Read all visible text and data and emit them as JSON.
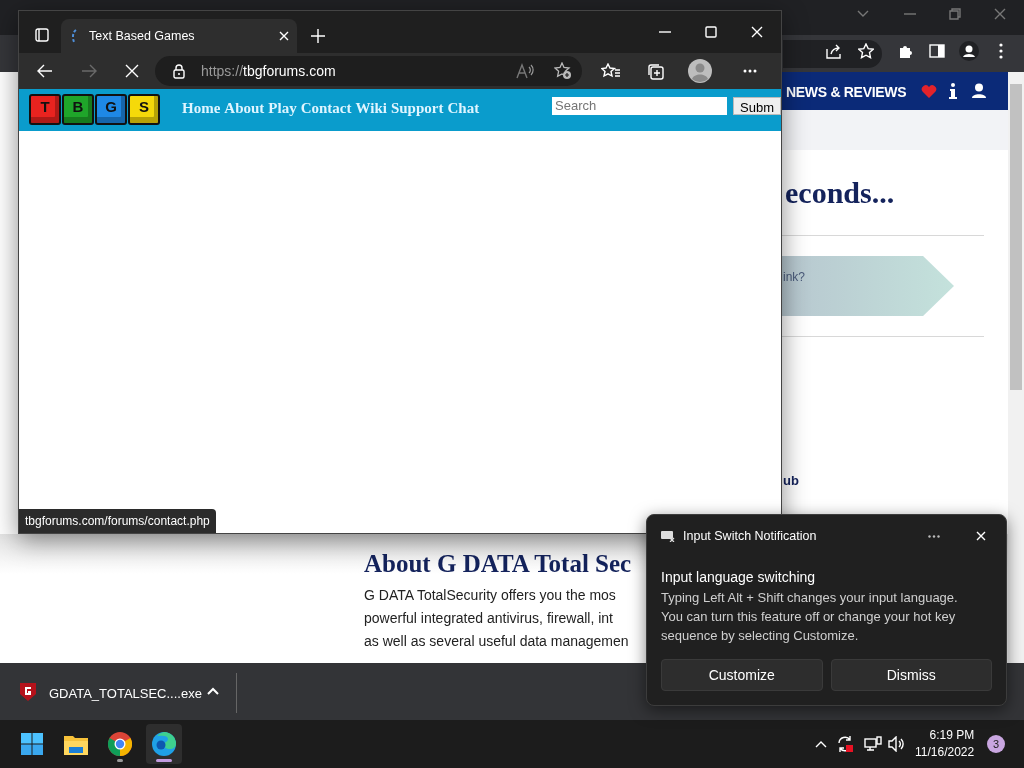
{
  "background_browser": {
    "nav_label": "NEWS & REVIEWS",
    "heading": "econds...",
    "banner_text": "ink?",
    "link_text": "ub",
    "section_heading": "About G DATA Total Sec",
    "paragraph_lines": [
      "G DATA TotalSecurity offers you the mos",
      "powerful integrated antivirus, firewall, int",
      "as well as several useful data managemen"
    ]
  },
  "edge": {
    "tab_title": "Text Based Games",
    "url_scheme": "https://",
    "url_host": "tbgforums.com",
    "loading": true,
    "site": {
      "logo_keys": [
        {
          "letter": "T",
          "color": "#e8231f"
        },
        {
          "letter": "B",
          "color": "#1fa52a"
        },
        {
          "letter": "G",
          "color": "#1e88e5"
        },
        {
          "letter": "S",
          "color": "#f5d90a"
        }
      ],
      "nav_links": [
        "Home",
        "About",
        "Play",
        "Contact",
        "Wiki",
        "Support",
        "Chat"
      ],
      "search_placeholder": "Search",
      "submit_label": "Subm"
    },
    "status_url": "tbgforums.com/forums/contact.php"
  },
  "download_bar": {
    "file_name": "GDATA_TOTALSEC....exe"
  },
  "notification": {
    "app": "Input Switch Notification",
    "title": "Input language switching",
    "body": "Typing Left Alt + Shift changes your input language. You can turn this feature off or change your hot key sequence by selecting Customize.",
    "buttons": [
      "Customize",
      "Dismiss"
    ]
  },
  "taskbar": {
    "apps": [
      {
        "kind": "start",
        "running": false,
        "selected": false
      },
      {
        "kind": "explorer",
        "running": false,
        "selected": false
      },
      {
        "kind": "chrome",
        "running": true,
        "selected": false
      },
      {
        "kind": "edge",
        "running": true,
        "selected": true
      }
    ],
    "time": "6:19 PM",
    "date": "11/16/2022",
    "notification_count": "3"
  }
}
